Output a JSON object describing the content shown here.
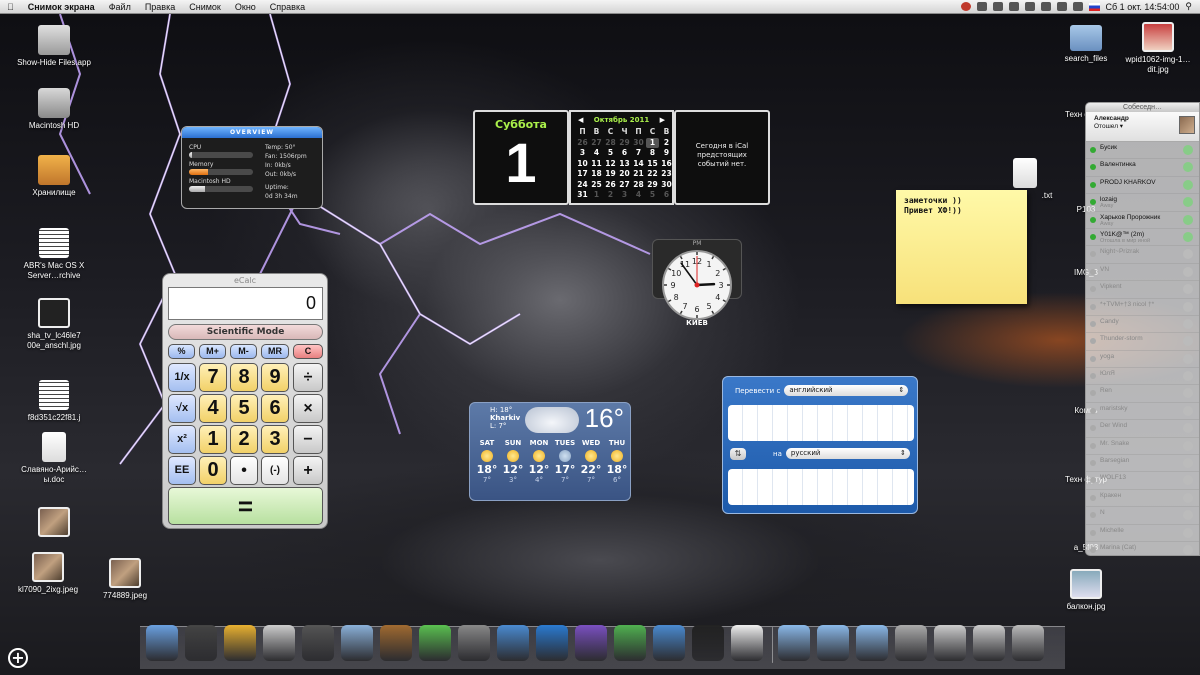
{
  "menubar": {
    "app": "Снимок экрана",
    "items": [
      "Файл",
      "Правка",
      "Снимок",
      "Окно",
      "Справка"
    ],
    "clock": "Сб 1 окт.  14:54:00"
  },
  "desktop_icons": [
    {
      "label": "Show-Hide Files.app",
      "icon": "app-icon"
    },
    {
      "label": "Macintosh HD",
      "icon": "hard-drive-icon"
    },
    {
      "label": "Хранилище",
      "icon": "usb-drive-icon"
    },
    {
      "label": "ABR's Mac OS X Server…rchive",
      "icon": "archive-icon"
    },
    {
      "label": "sha_tv_lc46le7 00e_anschl.jpg",
      "icon": "image-icon"
    },
    {
      "label": "f8d351c22f81.j",
      "icon": "image-icon"
    },
    {
      "label": "Славяно-Арийс…ы.doc",
      "icon": "document-icon"
    },
    {
      "label": "kl7090_2ixg.jpeg",
      "icon": "image-icon"
    },
    {
      "label": "774889.jpeg",
      "icon": "image-icon"
    },
    {
      "label": "search_files",
      "icon": "folder-icon"
    },
    {
      "label": "wpid1062-img-1…dit.jpg",
      "icon": "image-icon"
    },
    {
      "label": "Техн футур",
      "icon": "document-icon"
    },
    {
      "label": "P103",
      "icon": "image-icon"
    },
    {
      "label": "IMG_3",
      "icon": "image-icon"
    },
    {
      "label": "Компь",
      "icon": "document-icon"
    },
    {
      "label": "Техн футур",
      "icon": "document-icon"
    },
    {
      "label": "a_5f03",
      "icon": "image-icon"
    },
    {
      "label": "балкон.jpg",
      "icon": "image-icon"
    },
    {
      "label": ".txt",
      "icon": "document-icon"
    }
  ],
  "overview": {
    "title": "OVERVIEW",
    "cpu_label": "CPU",
    "memory_label": "Memory",
    "disk_label": "Macintosh HD",
    "cpu_level": 0.05,
    "memory_level": 0.3,
    "disk_level": 0.25,
    "temp": "Temp: 50°",
    "fan": "Fan: 1506rpm",
    "in": "In: 0kb/s",
    "out": "Out: 0kb/s",
    "uptime_label": "Uptime:",
    "uptime": "0d 3h 34m"
  },
  "calendar": {
    "weekday": "Суббота",
    "day": "1",
    "month": "Октябрь 2011",
    "weekday_headers": [
      "П",
      "В",
      "С",
      "Ч",
      "П",
      "С",
      "В"
    ],
    "weeks": [
      [
        "26",
        "27",
        "28",
        "29",
        "30",
        "1",
        "2"
      ],
      [
        "3",
        "4",
        "5",
        "6",
        "7",
        "8",
        "9"
      ],
      [
        "10",
        "11",
        "12",
        "13",
        "14",
        "15",
        "16"
      ],
      [
        "17",
        "18",
        "19",
        "20",
        "21",
        "22",
        "23"
      ],
      [
        "24",
        "25",
        "26",
        "27",
        "28",
        "29",
        "30"
      ],
      [
        "31",
        "1",
        "2",
        "3",
        "4",
        "5",
        "6"
      ]
    ],
    "events_text": "Сегодня в iCal предстоящих событий нет."
  },
  "clock_widget": {
    "period": "PM",
    "city": "КИЕВ",
    "hour": 2,
    "minute": 54,
    "second": 0
  },
  "note": {
    "text": "заметочки ))\nПривет ХФ!))"
  },
  "ecalc": {
    "title": "eCalc",
    "display": "0",
    "mode": "Scientific Mode",
    "mem_keys": [
      "%",
      "M+",
      "M-",
      "MR",
      "C"
    ],
    "func_keys": [
      "1/x",
      "√x",
      "x²",
      "EE"
    ],
    "digit_rows": [
      [
        "7",
        "8",
        "9"
      ],
      [
        "4",
        "5",
        "6"
      ],
      [
        "1",
        "2",
        "3"
      ],
      [
        "0",
        "•",
        "(-)"
      ]
    ],
    "op_keys": [
      "÷",
      "×",
      "−",
      "+"
    ],
    "equals": "="
  },
  "weather": {
    "city": "Kharkiv",
    "hi": "H: 18°",
    "lo": "L: 7°",
    "temp": "16°",
    "days": [
      {
        "day": "SAT",
        "hi": "18°",
        "lo": "7°"
      },
      {
        "day": "SUN",
        "hi": "12°",
        "lo": "3°"
      },
      {
        "day": "MON",
        "hi": "12°",
        "lo": "4°"
      },
      {
        "day": "TUES",
        "hi": "17°",
        "lo": "7°"
      },
      {
        "day": "WED",
        "hi": "22°",
        "lo": "7°"
      },
      {
        "day": "THU",
        "hi": "18°",
        "lo": "6°"
      }
    ]
  },
  "translate": {
    "from_label": "Перевести с",
    "from_lang": "английский",
    "to_label": "на",
    "to_lang": "русский"
  },
  "buddy_list": {
    "title": "Собеседн…",
    "me": {
      "name": "Александр",
      "status": "Отошел ▾"
    },
    "contacts": [
      {
        "name": "Бусик",
        "sub": "",
        "online": true
      },
      {
        "name": "Валентинка",
        "sub": "",
        "online": true
      },
      {
        "name": "PRODJ KHARKOV",
        "sub": "",
        "online": true
      },
      {
        "name": "lozaig",
        "sub": "Away",
        "online": true
      },
      {
        "name": "Харьков Пророжник",
        "sub": "Away",
        "online": true
      },
      {
        "name": "Y01K@™ (2m)",
        "sub": "Отошла в мир иной",
        "online": true
      },
      {
        "name": "Night~Prizrak",
        "sub": "",
        "online": false
      },
      {
        "name": "VN",
        "sub": "",
        "online": false
      },
      {
        "name": "Vipkent",
        "sub": "",
        "online": false
      },
      {
        "name": "*+TVM+†3 nicol †*",
        "sub": "",
        "online": false
      },
      {
        "name": "Candy",
        "sub": "",
        "online": false
      },
      {
        "name": "Thunder-storm",
        "sub": "",
        "online": false
      },
      {
        "name": "yoga",
        "sub": "",
        "online": false
      },
      {
        "name": "ЮлЯ",
        "sub": "",
        "online": false
      },
      {
        "name": "Ren",
        "sub": "",
        "online": false
      },
      {
        "name": "maristsky",
        "sub": "",
        "online": false
      },
      {
        "name": "Der Wind",
        "sub": "",
        "online": false
      },
      {
        "name": "Mr. Snake",
        "sub": "",
        "online": false
      },
      {
        "name": "Barsegian",
        "sub": "",
        "online": false
      },
      {
        "name": "WOLF13",
        "sub": "",
        "online": false
      },
      {
        "name": "Кракен",
        "sub": "",
        "online": false
      },
      {
        "name": "N",
        "sub": "",
        "online": false
      },
      {
        "name": "Michelle",
        "sub": "",
        "online": false
      },
      {
        "name": "Marina (Cat)",
        "sub": "",
        "online": false
      }
    ]
  },
  "dock": {
    "apps": [
      "finder-icon",
      "dashboard-icon",
      "chrome-icon",
      "preview-icon",
      "stats-icon",
      "iphoto-icon",
      "cog-icon",
      "adium-icon",
      "system-preferences-icon",
      "time-machine-icon",
      "word-icon",
      "skype-icon",
      "utorrent-icon",
      "app-store-icon",
      "activity-monitor-icon",
      "textedit-icon",
      "applications-folder-icon",
      "documents-folder-icon",
      "pictures-folder-icon",
      "downloads-stack-icon",
      "screenshot-stack-icon",
      "desktop-stack-icon",
      "trash-icon"
    ]
  }
}
